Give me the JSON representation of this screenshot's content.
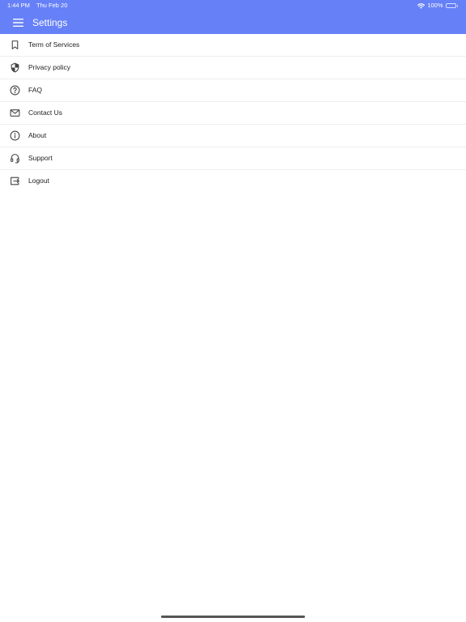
{
  "status_bar": {
    "time": "1:44 PM",
    "date": "Thu Feb 20",
    "battery": "100%",
    "battery_level": 1.0,
    "wifi_icon": "wifi-icon",
    "battery_icon": "battery-icon"
  },
  "header": {
    "title": "Settings",
    "menu_icon": "hamburger-menu-icon",
    "background_color": "#6680f7"
  },
  "settings": {
    "items": [
      {
        "label": "Term of Services",
        "icon": "bookmark-icon"
      },
      {
        "label": "Privacy policy",
        "icon": "shield-icon"
      },
      {
        "label": "FAQ",
        "icon": "help-circle-icon"
      },
      {
        "label": "Contact Us",
        "icon": "mail-icon"
      },
      {
        "label": "About",
        "icon": "info-icon"
      },
      {
        "label": "Support",
        "icon": "headset-icon"
      },
      {
        "label": "Logout",
        "icon": "logout-icon"
      }
    ]
  }
}
